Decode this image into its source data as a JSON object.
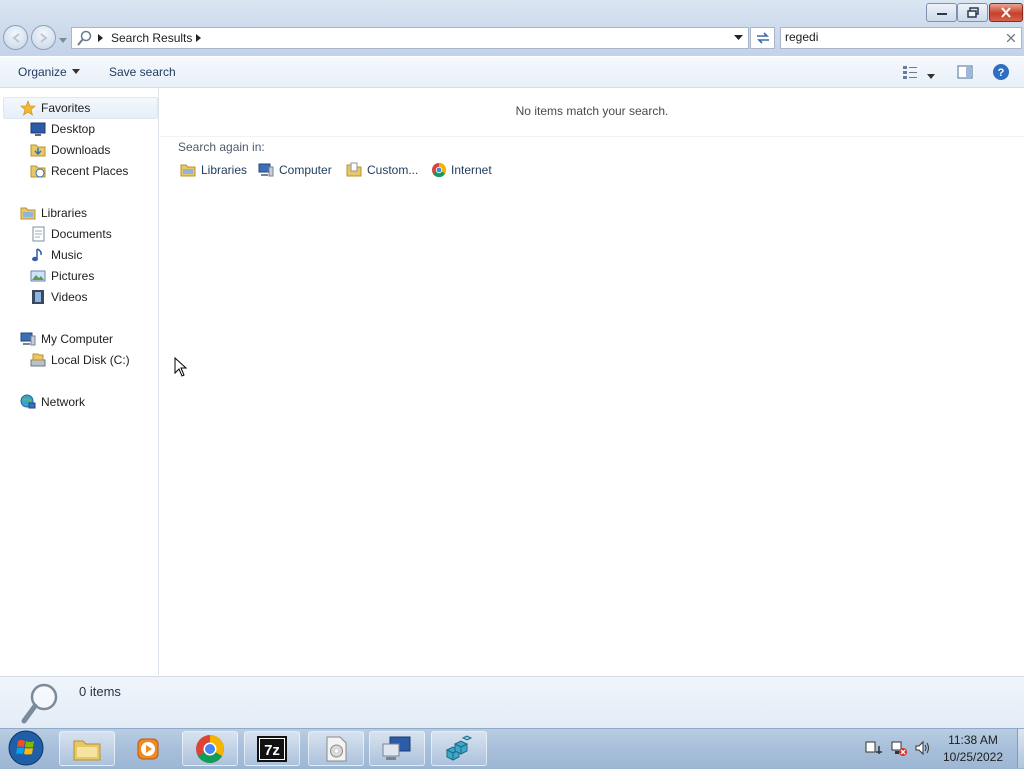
{
  "window": {
    "breadcrumb": "Search Results",
    "search_value": "regedi"
  },
  "toolbar": {
    "organize_label": "Organize",
    "save_search_label": "Save search"
  },
  "nav": {
    "favorites": {
      "label": "Favorites",
      "items": [
        {
          "label": "Desktop",
          "icon": "desktop-icon"
        },
        {
          "label": "Downloads",
          "icon": "downloads-folder-icon"
        },
        {
          "label": "Recent Places",
          "icon": "recent-places-icon"
        }
      ]
    },
    "libraries": {
      "label": "Libraries",
      "items": [
        {
          "label": "Documents",
          "icon": "documents-icon"
        },
        {
          "label": "Music",
          "icon": "music-icon"
        },
        {
          "label": "Pictures",
          "icon": "pictures-icon"
        },
        {
          "label": "Videos",
          "icon": "videos-icon"
        }
      ]
    },
    "computer": {
      "label": "My Computer",
      "items": [
        {
          "label": "Local Disk (C:)",
          "icon": "local-disk-icon"
        }
      ]
    },
    "network": {
      "label": "Network"
    }
  },
  "content": {
    "no_items_message": "No items match your search.",
    "search_again_label": "Search again in:",
    "locations": [
      {
        "label": "Libraries",
        "icon": "libraries-icon"
      },
      {
        "label": "Computer",
        "icon": "computer-icon"
      },
      {
        "label": "Custom...",
        "icon": "custom-folder-icon"
      },
      {
        "label": "Internet",
        "icon": "chrome-icon"
      }
    ]
  },
  "status": {
    "count": "0 items"
  },
  "taskbar": {
    "time": "11:38 AM",
    "date": "10/25/2022",
    "apps": [
      "file-explorer-icon",
      "media-player-icon",
      "chrome-icon",
      "7zip-icon",
      "disc-image-icon",
      "remote-desktop-icon",
      "registry-editor-icon"
    ]
  },
  "colors": {
    "accent": "#1e3a5f",
    "taskbar": "#a7bfda"
  }
}
